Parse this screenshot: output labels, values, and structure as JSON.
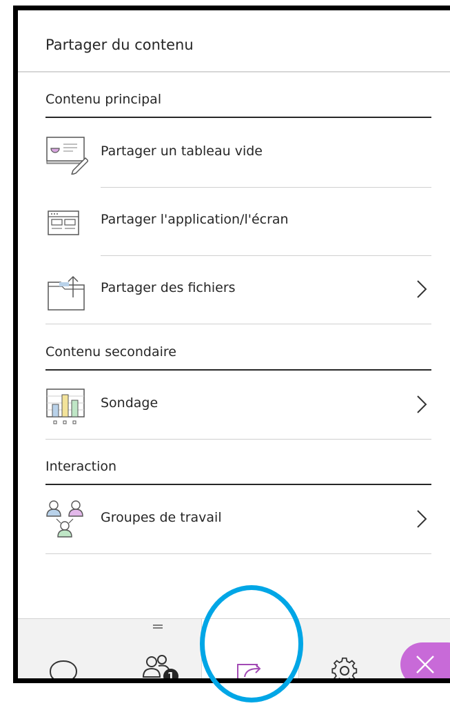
{
  "panel": {
    "title": "Partager du contenu"
  },
  "sections": [
    {
      "heading": "Contenu principal",
      "items": [
        {
          "label": "Partager un tableau vide",
          "icon": "whiteboard-icon",
          "has_chevron": false
        },
        {
          "label": "Partager l'application/l'écran",
          "icon": "app-window-icon",
          "has_chevron": false
        },
        {
          "label": "Partager des fichiers",
          "icon": "folder-upload-icon",
          "has_chevron": true
        }
      ]
    },
    {
      "heading": "Contenu secondaire",
      "items": [
        {
          "label": "Sondage",
          "icon": "poll-chart-icon",
          "has_chevron": true
        }
      ]
    },
    {
      "heading": "Interaction",
      "items": [
        {
          "label": "Groupes de travail",
          "icon": "breakout-groups-icon",
          "has_chevron": true
        }
      ]
    }
  ],
  "bottom_bar": {
    "tabs": [
      {
        "name": "chat",
        "icon": "chat-bubble-icon"
      },
      {
        "name": "participants",
        "icon": "participants-icon",
        "badge": "1"
      },
      {
        "name": "share-content",
        "icon": "share-content-icon",
        "active": true
      },
      {
        "name": "settings",
        "icon": "gear-icon"
      },
      {
        "name": "close",
        "icon": "close-icon"
      }
    ]
  },
  "colors": {
    "accent": "#7b2a8f",
    "close_button": "#c86ad8",
    "highlight_ring": "#00a6e6",
    "text": "#262626"
  }
}
